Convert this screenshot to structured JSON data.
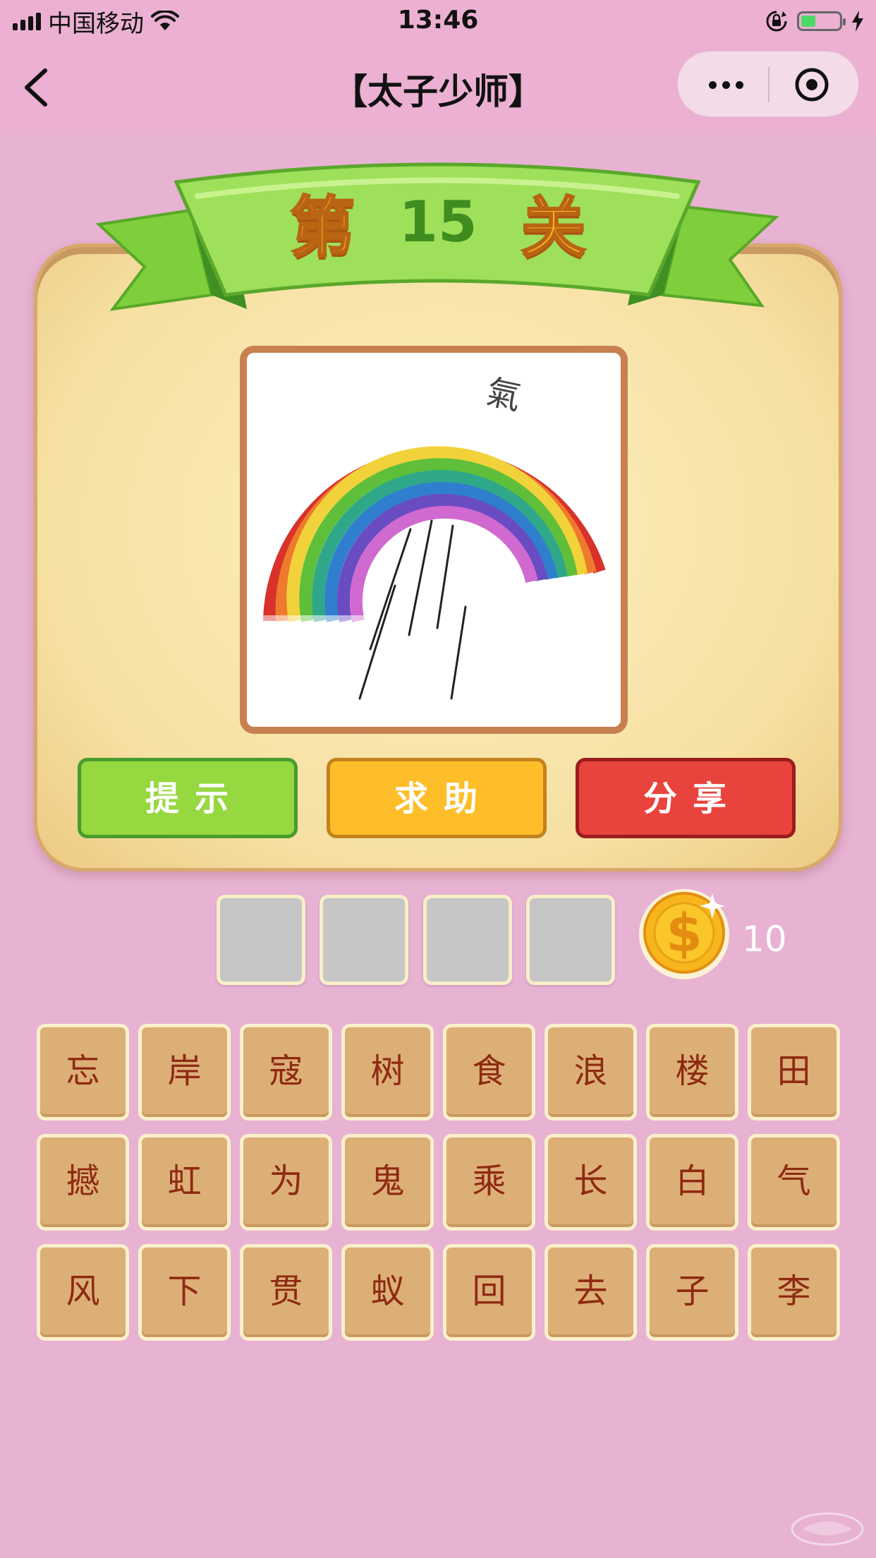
{
  "status_bar": {
    "carrier": "中国移动",
    "time": "13:46"
  },
  "nav": {
    "title": "【太子少师】"
  },
  "level": {
    "prefix": "第",
    "number": "15",
    "suffix": "关"
  },
  "puzzle": {
    "image_text": "氣"
  },
  "actions": {
    "hint": "提示",
    "help": "求助",
    "share": "分享"
  },
  "coins": {
    "count": "10"
  },
  "answer_slots": [
    "",
    "",
    "",
    ""
  ],
  "tiles": [
    "忘",
    "岸",
    "寇",
    "树",
    "食",
    "浪",
    "楼",
    "田",
    "撼",
    "虹",
    "为",
    "鬼",
    "乘",
    "长",
    "白",
    "气",
    "风",
    "下",
    "贯",
    "蚁",
    "回",
    "去",
    "子",
    "李"
  ],
  "colors": {
    "background": "#e8b2d3",
    "hint": "#95d83f",
    "help": "#fdbe2a",
    "share": "#e8433c",
    "tile": "#dcaf77",
    "tile_text": "#8e2a12"
  },
  "icons": [
    "wifi-icon",
    "lock-rotation-icon",
    "battery-icon",
    "charging-icon",
    "back-chevron-icon",
    "more-dots-icon",
    "close-target-icon",
    "coin-icon"
  ]
}
